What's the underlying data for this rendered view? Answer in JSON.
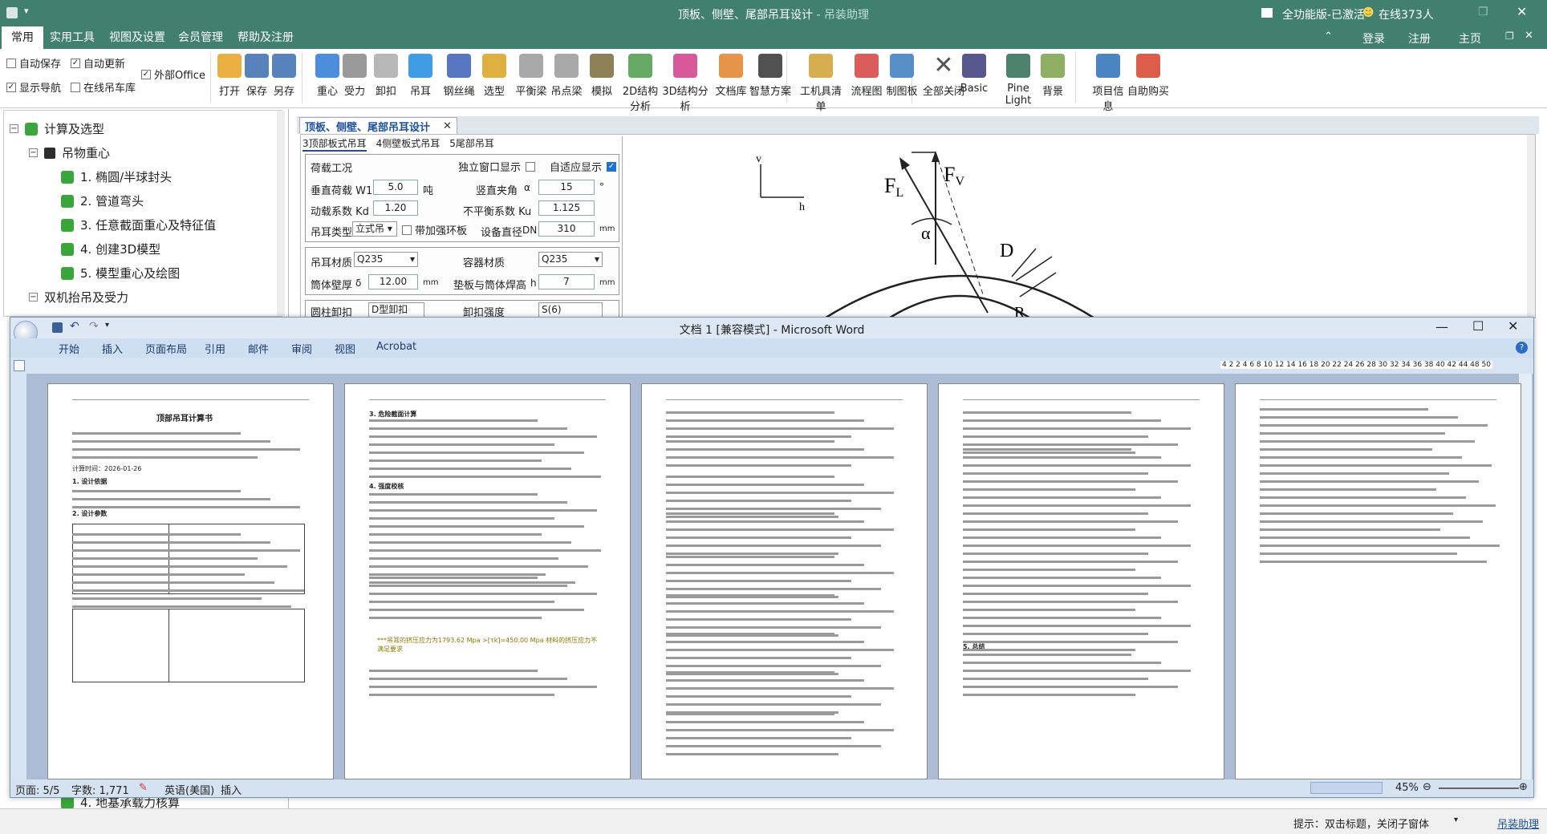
{
  "app": {
    "title": "顶板、侧壁、尾部吊耳设计",
    "title_suffix": " - 吊装助理",
    "status_activated": "全功能版-已激活",
    "online": "在线373人",
    "login": "登录",
    "register": "注册",
    "home": "主页"
  },
  "menu": [
    "常用",
    "实用工具",
    "视图及设置",
    "会员管理",
    "帮助及注册"
  ],
  "options": {
    "auto_save": "自动保存",
    "auto_update": "自动更新",
    "external_office": "外部Office",
    "show_nav": "显示导航",
    "online_crane_lib": "在线吊车库"
  },
  "ribbon": [
    {
      "label": "打开",
      "icon": "folder-icon"
    },
    {
      "label": "保存",
      "icon": "save-icon"
    },
    {
      "label": "另存",
      "icon": "save-as-icon"
    },
    {
      "label": "重心",
      "icon": "center-of-gravity-icon"
    },
    {
      "label": "受力",
      "icon": "force-icon"
    },
    {
      "label": "卸扣",
      "icon": "shackle-icon"
    },
    {
      "label": "吊耳",
      "icon": "lug-icon"
    },
    {
      "label": "钢丝绳",
      "icon": "wire-rope-icon"
    },
    {
      "label": "选型",
      "icon": "crane-select-icon"
    },
    {
      "label": "平衡梁",
      "icon": "balance-beam-icon"
    },
    {
      "label": "吊点梁",
      "icon": "lifting-beam-icon"
    },
    {
      "label": "模拟",
      "icon": "simulate-icon"
    },
    {
      "label": "2D结构分析",
      "icon": "chart-2d-icon"
    },
    {
      "label": "3D结构分析",
      "icon": "chart-3d-icon"
    },
    {
      "label": "文档库",
      "icon": "doc-library-icon"
    },
    {
      "label": "智慧方案",
      "icon": "smart-plan-icon"
    },
    {
      "label": "工机具清单",
      "icon": "tool-list-icon"
    },
    {
      "label": "流程图",
      "icon": "flowchart-icon"
    },
    {
      "label": "制图板",
      "icon": "drawing-board-icon"
    },
    {
      "label": "全部关闭",
      "icon": "close-all-icon"
    },
    {
      "label": "Basic",
      "icon": "theme-basic-icon"
    },
    {
      "label": "Pine Light",
      "icon": "theme-pine-icon"
    },
    {
      "label": "背景",
      "icon": "background-icon"
    },
    {
      "label": "项目信息",
      "icon": "info-icon"
    },
    {
      "label": "自助购买",
      "icon": "cart-icon"
    }
  ],
  "tree": {
    "root": "计算及选型",
    "group1": "吊物重心",
    "items": [
      "1. 椭圆/半球封头",
      "2. 管道弯头",
      "3. 任意截面重心及特征值",
      "4. 创建3D模型",
      "5. 模型重心及绘图"
    ],
    "group2": "双机抬吊及受力",
    "bottom_item": "4. 地基承载力核算"
  },
  "doc_tab": "顶板、侧壁、尾部吊耳设计",
  "sub_tabs": [
    "3顶部板式吊耳",
    "4侧壁板式吊耳",
    "5尾部吊耳"
  ],
  "form": {
    "load_case": "荷载工况",
    "independent_window": "独立窗口显示",
    "auto_adapt": "自适应显示",
    "vertical_load": "垂直荷载 W1",
    "vertical_load_value": "5.0",
    "ton": "吨",
    "vertical_angle": "竖直夹角",
    "alpha": "α",
    "vertical_angle_value": "15",
    "degree": "°",
    "dynamic_factor": "动载系数 Kd",
    "dynamic_factor_value": "1.20",
    "unbalance_factor": "不平衡系数 Ku",
    "unbalance_factor_value": "1.125",
    "lug_type": "吊耳类型",
    "lug_type_value": "立式吊",
    "ring_plate": "带加强环板",
    "equip_diameter": "设备直径",
    "dn": "DN",
    "equip_diameter_value": "310",
    "mm": "mm",
    "lug_material": "吊耳材质",
    "lug_material_value": "Q235",
    "vessel_material": "容器材质",
    "vessel_material_value": "Q235",
    "shell_thickness": "筒体壁厚",
    "delta": "δ",
    "shell_thickness_value": "12.00",
    "weld_height": "垫板与筒体焊高",
    "h": "h",
    "weld_height_value": "7",
    "partial_1": "圆柱卸扣",
    "partial_2": "卸扣强度",
    "partial_value1": "D型卸扣",
    "partial_value2": "S(6)"
  },
  "diagram": {
    "v": "v",
    "h": "h",
    "fl": "F",
    "fl_sub": "L",
    "fv": "F",
    "fv_sub": "V",
    "alpha": "α",
    "d": "D",
    "r": "R"
  },
  "app_status": {
    "hint": "提示：双击标题，关闭子窗体",
    "link": "吊装助理"
  },
  "word": {
    "title": "文档 1 [兼容模式] - Microsoft Word",
    "tabs": [
      "开始",
      "插入",
      "页面布局",
      "引用",
      "邮件",
      "审阅",
      "视图",
      "Acrobat"
    ],
    "ruler": "4 2 2 4 6 8 10 12 14 16 18 20 22 24 26 28 30 32 34 36 38 40 42 44 48 50",
    "page_info": "页面: 5/5",
    "word_count": "字数: 1,771",
    "language": "英语(美国)",
    "insert": "插入",
    "zoom": "45%",
    "page1_title": "顶部吊耳计算书",
    "p1_s1": "1. 设计依据",
    "p1_s2": "2. 设计参数",
    "p2_s3": "3. 危险截面计算",
    "p2_s4": "4. 强度校核",
    "p4_s5": "5. 总结",
    "p1_date": "计算时间：2026-01-26",
    "p2_result": "***吊耳的挤压应力为1793.62 Mpa >[τk]=450.00 Mpa 材料的挤压应力不满足要求"
  }
}
